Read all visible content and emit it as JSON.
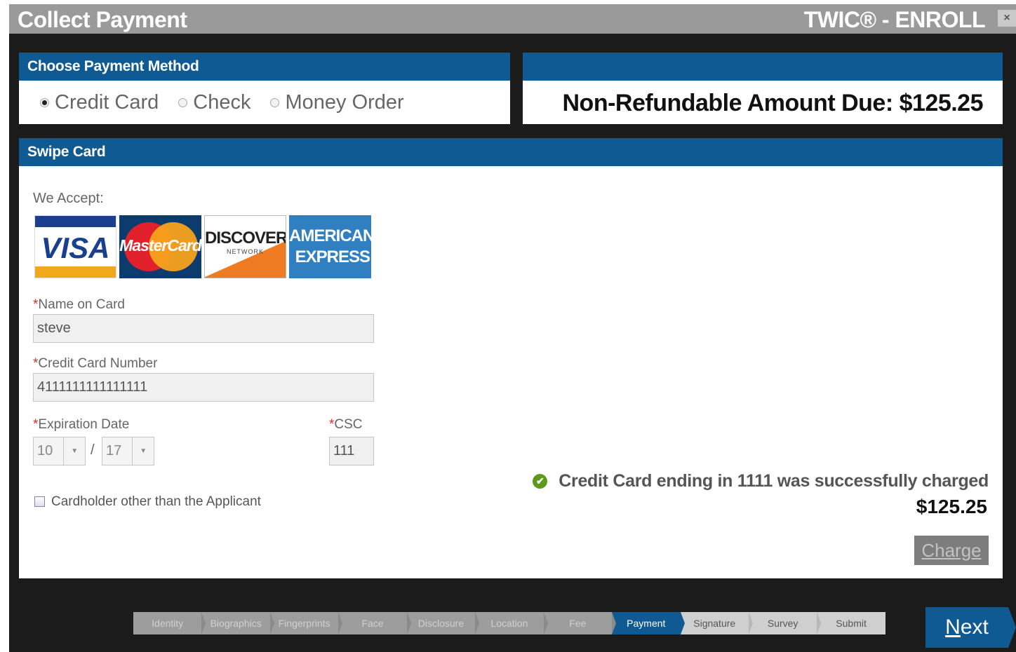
{
  "window": {
    "title": "Collect Payment",
    "brand": "TWIC® - ENROLL",
    "close_label": "×"
  },
  "payment_method": {
    "header": "Choose Payment Method",
    "options": [
      {
        "label": "Credit Card",
        "selected": true
      },
      {
        "label": "Check",
        "selected": false
      },
      {
        "label": "Money Order",
        "selected": false
      }
    ]
  },
  "amount_due": {
    "label": "Non-Refundable Amount Due:",
    "value": "$125.25"
  },
  "swipe": {
    "header": "Swipe Card",
    "accept_label": "We Accept:",
    "card_brands": {
      "visa": "VISA",
      "mastercard": "MasterCard",
      "discover": "DISCOVER",
      "discover_sub": "NETWORK",
      "amex_line1": "AMERICAN",
      "amex_line2": "EXPRESS"
    },
    "name_label": "Name on Card",
    "name_value": "steve",
    "number_label": "Credit Card Number",
    "number_value": "4111111111111111",
    "exp_label": "Expiration Date",
    "exp_month": "10",
    "exp_year": "17",
    "exp_sep": "/",
    "csc_label": "CSC",
    "csc_value": "111",
    "required_mark": "*",
    "cardholder_label": "Cardholder other than the Applicant",
    "cardholder_checked": false,
    "success_message": "Credit Card ending in 1111 was successfully charged",
    "charged_amount": "$125.25",
    "charge_label": "Charge"
  },
  "wizard": {
    "steps": [
      "Identity",
      "Biographics",
      "Fingerprints",
      "Face",
      "Disclosure",
      "Location",
      "Fee",
      "Payment",
      "Signature",
      "Survey",
      "Submit"
    ],
    "active": "Payment"
  },
  "next_label_first": "N",
  "next_label_rest": "ext",
  "colors": {
    "header_blue": "#0f5a92",
    "required_red": "#d0322b",
    "success_green": "#5c9b1a"
  }
}
